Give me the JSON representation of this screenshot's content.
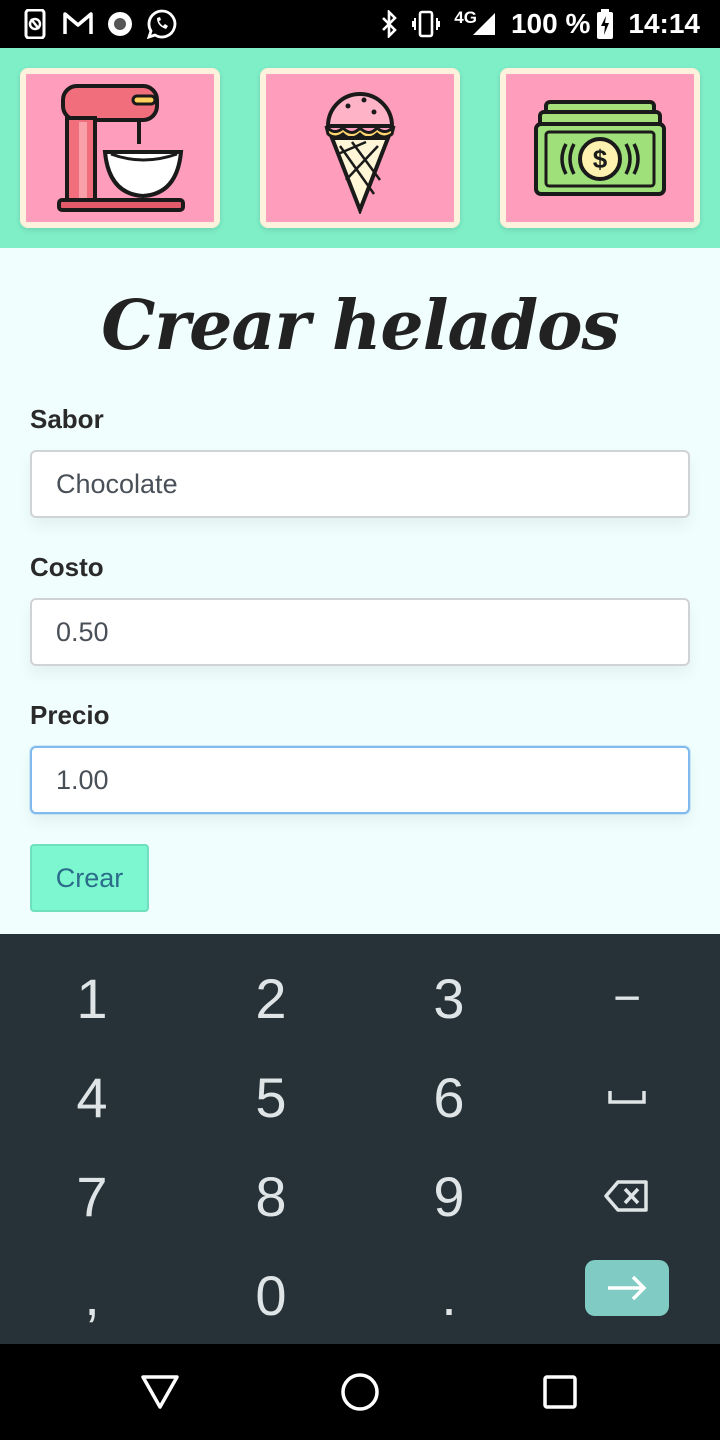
{
  "status_bar": {
    "left_icons": [
      "screen-share-icon",
      "gmail-icon",
      "record-icon",
      "whatsapp-icon"
    ],
    "right_icons": [
      "bluetooth-icon",
      "vibrate-icon",
      "signal-icon",
      "battery-charging-icon"
    ],
    "network": "4G",
    "battery": "100 %",
    "time": "14:14"
  },
  "banner": {
    "tiles": [
      {
        "icon": "stand-mixer-icon"
      },
      {
        "icon": "ice-cream-cone-icon"
      },
      {
        "icon": "money-bill-icon"
      }
    ]
  },
  "form": {
    "title": "Crear helados",
    "fields": [
      {
        "label": "Sabor",
        "value": "Chocolate"
      },
      {
        "label": "Costo",
        "value": "0.50"
      },
      {
        "label": "Precio",
        "value": "1.00"
      }
    ],
    "submit_label": "Crear"
  },
  "keyboard": {
    "rows": [
      [
        "1",
        "2",
        "3",
        "−"
      ],
      [
        "4",
        "5",
        "6",
        "space-icon"
      ],
      [
        "7",
        "8",
        "9",
        "backspace-icon"
      ],
      [
        ",",
        "0",
        ".",
        "enter-arrow-icon"
      ]
    ]
  },
  "nav_bar": {
    "buttons": [
      "back-icon",
      "home-icon",
      "recents-icon"
    ]
  },
  "colors": {
    "banner": "#7fefc7",
    "tile_bg": "#ff9dbd",
    "content_bg": "#f0fffd",
    "button_bg": "#7cf7cf",
    "keyboard_bg": "#263238",
    "enter_key": "#80cbc4"
  }
}
